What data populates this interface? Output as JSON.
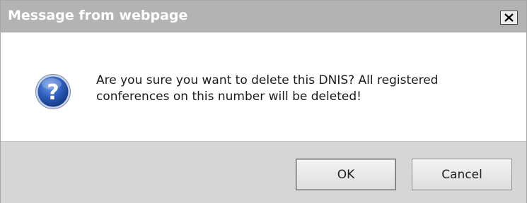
{
  "dialog": {
    "title": "Message from webpage",
    "close_label": "×",
    "icon": "question-icon",
    "message_line1": "Are you sure you want to delete this DNIS? All registered",
    "message_line2": "conferences on this number will be deleted!",
    "ok_label": "OK",
    "cancel_label": "Cancel"
  },
  "colors": {
    "titlebar": "#b3b3b3",
    "footer": "#d6d6d6",
    "icon_blue": "#1f4fa5"
  }
}
